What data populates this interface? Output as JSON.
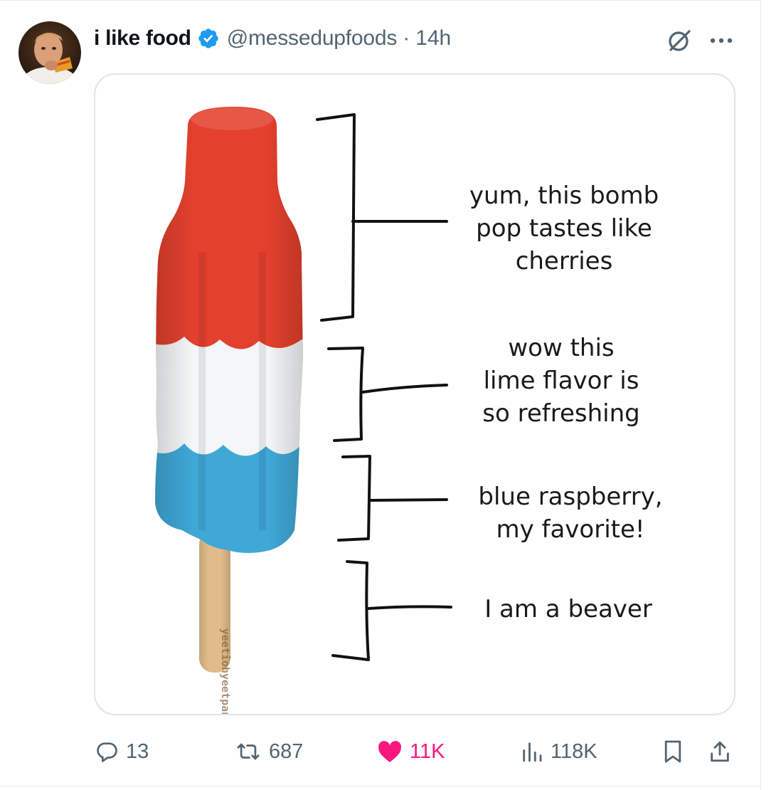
{
  "tweet": {
    "display_name": "i like food",
    "handle": "@messedupfoods",
    "separator": "·",
    "time": "14h"
  },
  "media": {
    "captions": [
      "yum, this bomb\npop tastes like\ncherries",
      "wow this\nlime flavor is\nso refreshing",
      "blue raspberry,\nmy favorite!",
      "I am a beaver"
    ],
    "watermark": "yeetiohyeetpants"
  },
  "actions": {
    "replies": "13",
    "reposts": "687",
    "likes": "11K",
    "views": "118K"
  },
  "icons": {
    "verified": "verified-badge-icon",
    "grok": "grok-icon",
    "more": "more-icon",
    "reply": "reply-icon",
    "repost": "repost-icon",
    "like": "heart-icon",
    "views": "views-icon",
    "bookmark": "bookmark-icon",
    "share": "share-icon"
  },
  "colors": {
    "verified": "#1d9bf0",
    "like": "#f91880",
    "muted": "#536471",
    "popsicle_red": "#e3402d",
    "popsicle_white": "#f4f6f7",
    "popsicle_blue": "#3fa8d6",
    "stick": "#e1bc8a"
  }
}
